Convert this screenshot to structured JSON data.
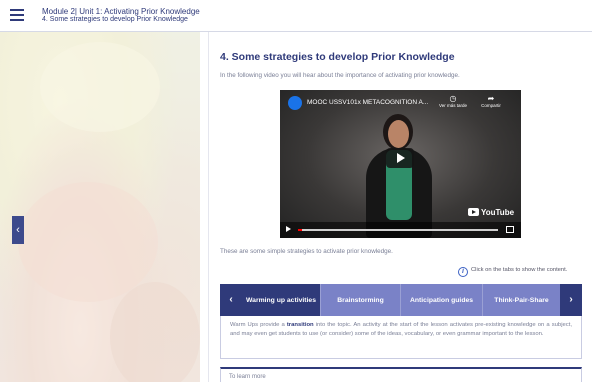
{
  "header": {
    "module": "Module 2| Unit 1: Activating Prior Knowledge",
    "section": "4. Some strategies to develop Prior Knowledge"
  },
  "page": {
    "title": "4. Some strategies to develop Prior Knowledge",
    "intro": "In the following video you will hear about the importance of activating prior knowledge.",
    "strategies_intro": "These are some simple strategies to activate prior knowledge.",
    "hint": "Click on the tabs to show the content."
  },
  "video": {
    "title": "MOOC USSV101x METACOGNITION A...",
    "watch_later": "Ver más tarde",
    "share": "Compartir",
    "brand": "YouTube",
    "progress": 0.02
  },
  "tabs": {
    "items": [
      {
        "label": "Warming up activities",
        "active": true
      },
      {
        "label": "Brainstorming",
        "active": false
      },
      {
        "label": "Anticipation guides",
        "active": false
      },
      {
        "label": "Think-Pair-Share",
        "active": false
      }
    ],
    "panel": {
      "pre": "Warm Ups provide a ",
      "bold": "transition",
      "post": " into the topic. An activity at the start of the lesson activates pre-existing knowledge on a subject, and may even get students to use (or consider) some of the ideas, vocabulary, or even grammar important to the lesson."
    }
  },
  "more": {
    "label": "To learn more"
  },
  "icons": {
    "menu": "hamburger-icon",
    "prev": "chevron-left-icon",
    "next": "chevron-right-icon",
    "info": "info-icon",
    "play": "play-icon",
    "clock": "clock-icon",
    "share": "share-arrow-icon",
    "fullscreen": "fullscreen-icon"
  },
  "colors": {
    "primary": "#2f3a7a",
    "tab_inactive": "#7a82c7",
    "progress": "#ff0000"
  }
}
